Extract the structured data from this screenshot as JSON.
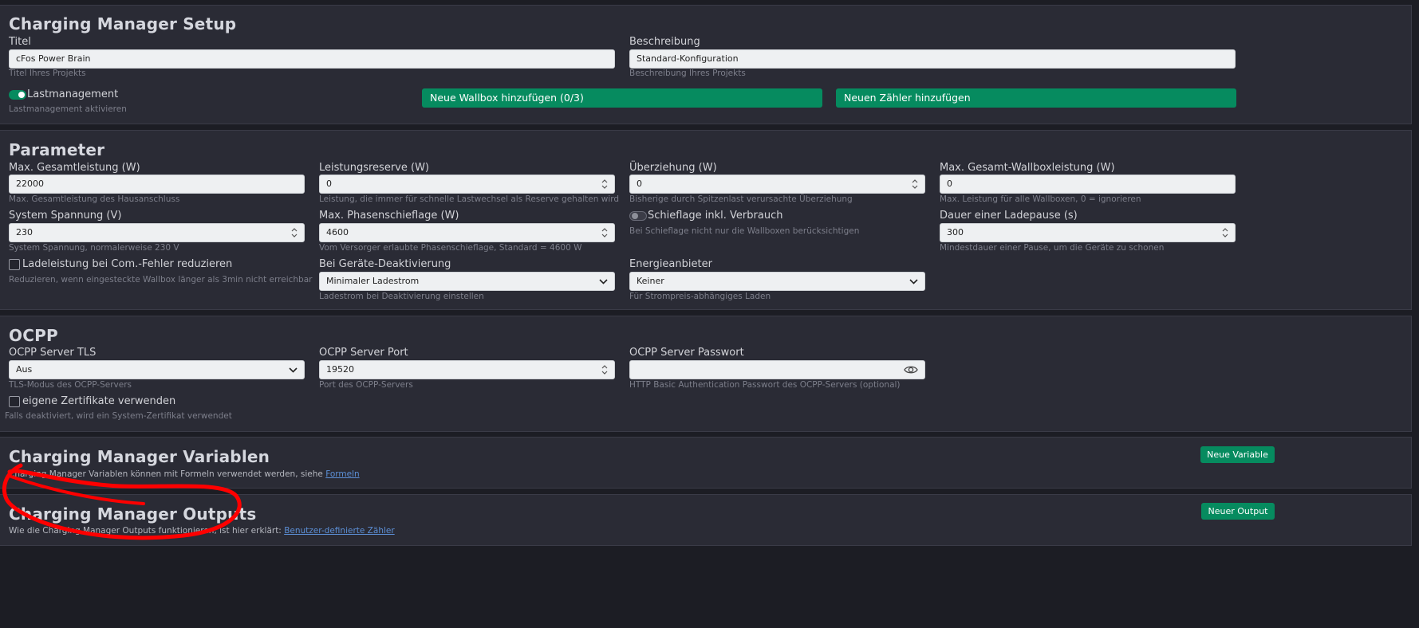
{
  "setup": {
    "heading": "Charging Manager Setup",
    "title_label": "Titel",
    "title_value": "cFos Power Brain",
    "title_hint": "Titel Ihres Projekts",
    "desc_label": "Beschreibung",
    "desc_value": "Standard-Konfiguration",
    "desc_hint": "Beschreibung Ihres Projekts",
    "lm_label": "Lastmanagement",
    "lm_hint": "Lastmanagement aktivieren",
    "lm_on": true,
    "add_wallbox": "Neue Wallbox hinzufügen (0/3)",
    "add_meter": "Neuen Zähler hinzufügen"
  },
  "params": {
    "heading": "Parameter",
    "fields": [
      {
        "label": "Max. Gesamtleistung (W)",
        "value": "22000",
        "hint": "Max. Gesamtleistung des Hausanschluss"
      },
      {
        "label": "Leistungsreserve (W)",
        "value": "0",
        "hint": "Leistung, die immer für schnelle Lastwechsel als Reserve gehalten wird"
      },
      {
        "label": "Überziehung (W)",
        "value": "0",
        "hint": "Bisherige durch Spitzenlast verursachte Überziehung"
      },
      {
        "label": "Max. Gesamt-Wallboxleistung (W)",
        "value": "0",
        "hint": "Max. Leistung für alle Wallboxen, 0 = ignorieren"
      },
      {
        "label": "System Spannung (V)",
        "value": "230",
        "hint": "System Spannung, normalerweise 230 V"
      },
      {
        "label": "Max. Phasenschieflage (W)",
        "value": "4600",
        "hint": "Vom Versorger erlaubte Phasenschieflage, Standard = 4600 W"
      },
      {
        "label": "Dauer einer Ladepause (s)",
        "value": "300",
        "hint": "Mindestdauer einer Pause, um die Geräte zu schonen"
      }
    ],
    "schief_label": "Schieflage inkl. Verbrauch",
    "schief_hint": "Bei Schieflage nicht nur die Wallboxen berücksichtigen",
    "lade_label": "Ladeleistung bei Com.-Fehler reduzieren",
    "lade_hint": "Reduzieren, wenn eingesteckte Wallbox länger als 3min nicht erreichbar",
    "deact_label": "Bei Geräte-Deaktivierung",
    "deact_value": "Minimaler Ladestrom",
    "deact_hint": "Ladestrom bei Deaktivierung einstellen",
    "energy_label": "Energieanbieter",
    "energy_value": "Keiner",
    "energy_hint": "Für Strompreis-abhängiges Laden"
  },
  "ocpp": {
    "heading": "OCPP",
    "tls_label": "OCPP Server TLS",
    "tls_value": "Aus",
    "tls_hint": "TLS-Modus des OCPP-Servers",
    "port_label": "OCPP Server Port",
    "port_value": "19520",
    "port_hint": "Port des OCPP-Servers",
    "pw_label": "OCPP Server Passwort",
    "pw_value": "",
    "pw_hint": "HTTP Basic Authentication Passwort des OCPP-Servers (optional)",
    "cert_label": "eigene Zertifikate verwenden",
    "cert_hint": "Falls deaktiviert, wird ein System-Zertifikat verwendet"
  },
  "variables": {
    "heading": "Charging Manager Variablen",
    "button": "Neue Variable",
    "text": "Charging Manager Variablen können mit Formeln verwendet werden, siehe ",
    "link": "Formeln"
  },
  "outputs": {
    "heading": "Charging Manager Outputs",
    "button": "Neuer Output",
    "text": "Wie die Charging Manager Outputs funktionieren, ist hier erklärt: ",
    "link": "Benutzer-definierte Zähler"
  },
  "colors": {
    "accent_green": "#068b5f",
    "annotation_red": "#ff0000"
  }
}
